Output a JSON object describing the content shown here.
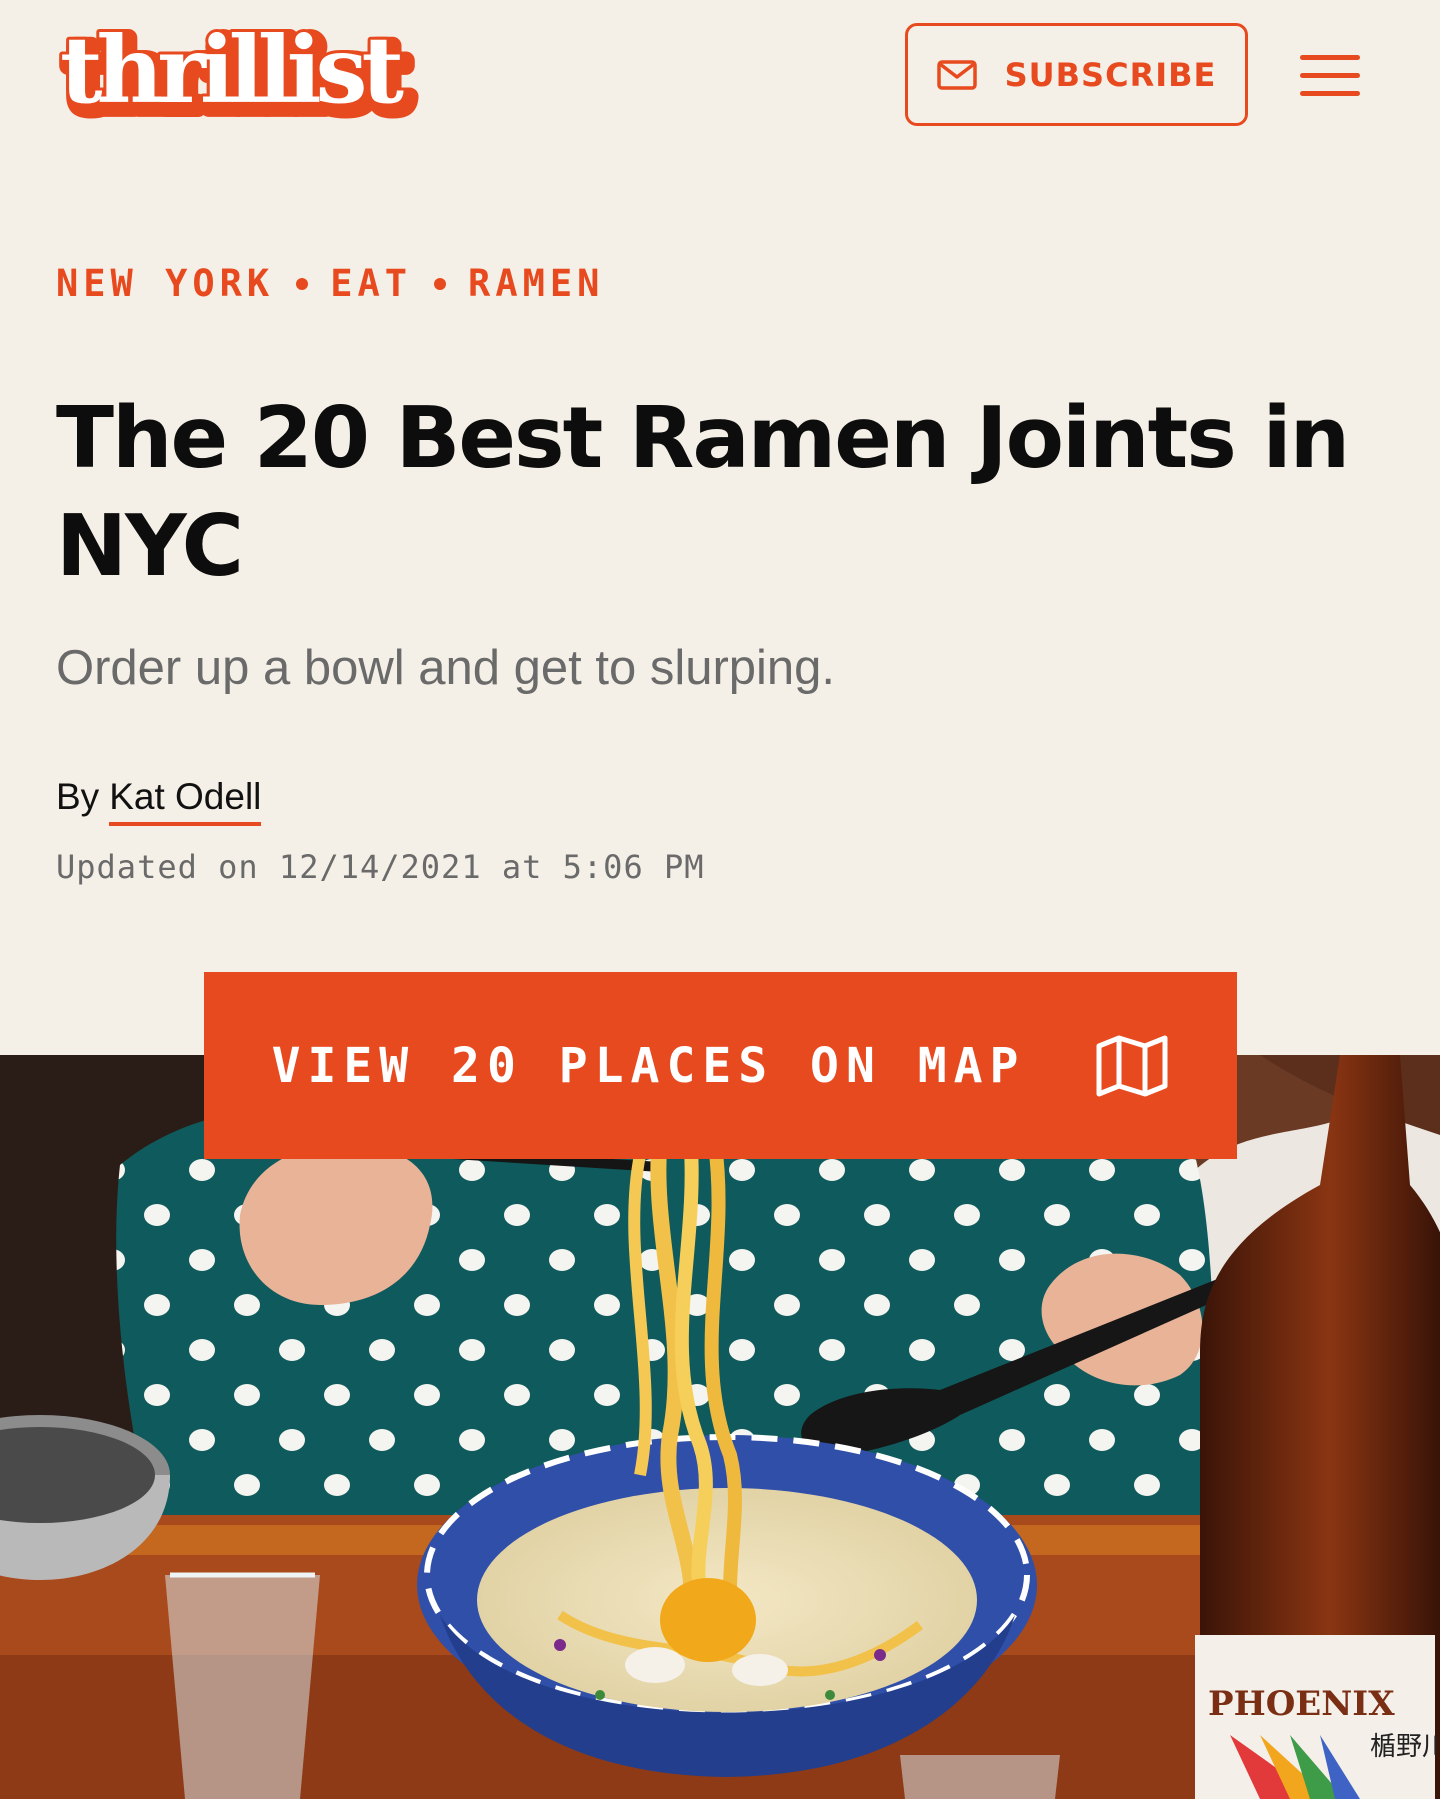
{
  "brand": {
    "logo_text": "thrillist",
    "accent": "#e84a1f",
    "background": "#f5f0e7"
  },
  "header": {
    "subscribe_label": "SUBSCRIBE",
    "subscribe_icon": "mail-icon",
    "menu_icon": "hamburger-menu-icon"
  },
  "breadcrumbs": [
    "NEW YORK",
    "EAT",
    "RAMEN"
  ],
  "article": {
    "title": "The 20 Best Ramen Joints in NYC",
    "subtitle": "Order up a bowl and get to slurping.",
    "by_prefix": "By",
    "author": "Kat Odell",
    "updated": "Updated on 12/14/2021 at 5:06 PM"
  },
  "map_button": {
    "label": "VIEW 20 PLACES ON MAP",
    "icon": "map-icon"
  },
  "hero_image": {
    "bottle_text": "PHOENIX",
    "bottle_kanji": "楯野川"
  }
}
